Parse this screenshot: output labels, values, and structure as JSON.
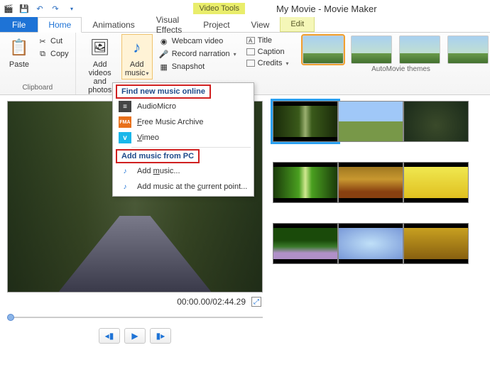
{
  "title": {
    "video_tools": "Video Tools",
    "app": "My Movie - Movie Maker"
  },
  "tabs": {
    "file": "File",
    "home": "Home",
    "animations": "Animations",
    "visual_effects": "Visual Effects",
    "project": "Project",
    "view": "View",
    "edit": "Edit"
  },
  "clipboard": {
    "paste": "Paste",
    "cut": "Cut",
    "copy": "Copy",
    "label": "Clipboard"
  },
  "add": {
    "videos_photos": "Add videos and photos",
    "music": "Add music"
  },
  "capture": {
    "webcam": "Webcam video",
    "narration": "Record narration",
    "snapshot": "Snapshot"
  },
  "text": {
    "title": "Title",
    "caption": "Caption",
    "credits": "Credits"
  },
  "themes_label": "AutoMovie themes",
  "dropdown": {
    "find_header": "Find new music online",
    "audiomicro": "AudioMicro",
    "fma": "Free Music Archive",
    "vimeo": "Vimeo",
    "pc_header": "Add music from PC",
    "add_music": "Add music...",
    "add_current": "Add music at the current point..."
  },
  "player": {
    "time": "00:00.00/02:44.29"
  }
}
